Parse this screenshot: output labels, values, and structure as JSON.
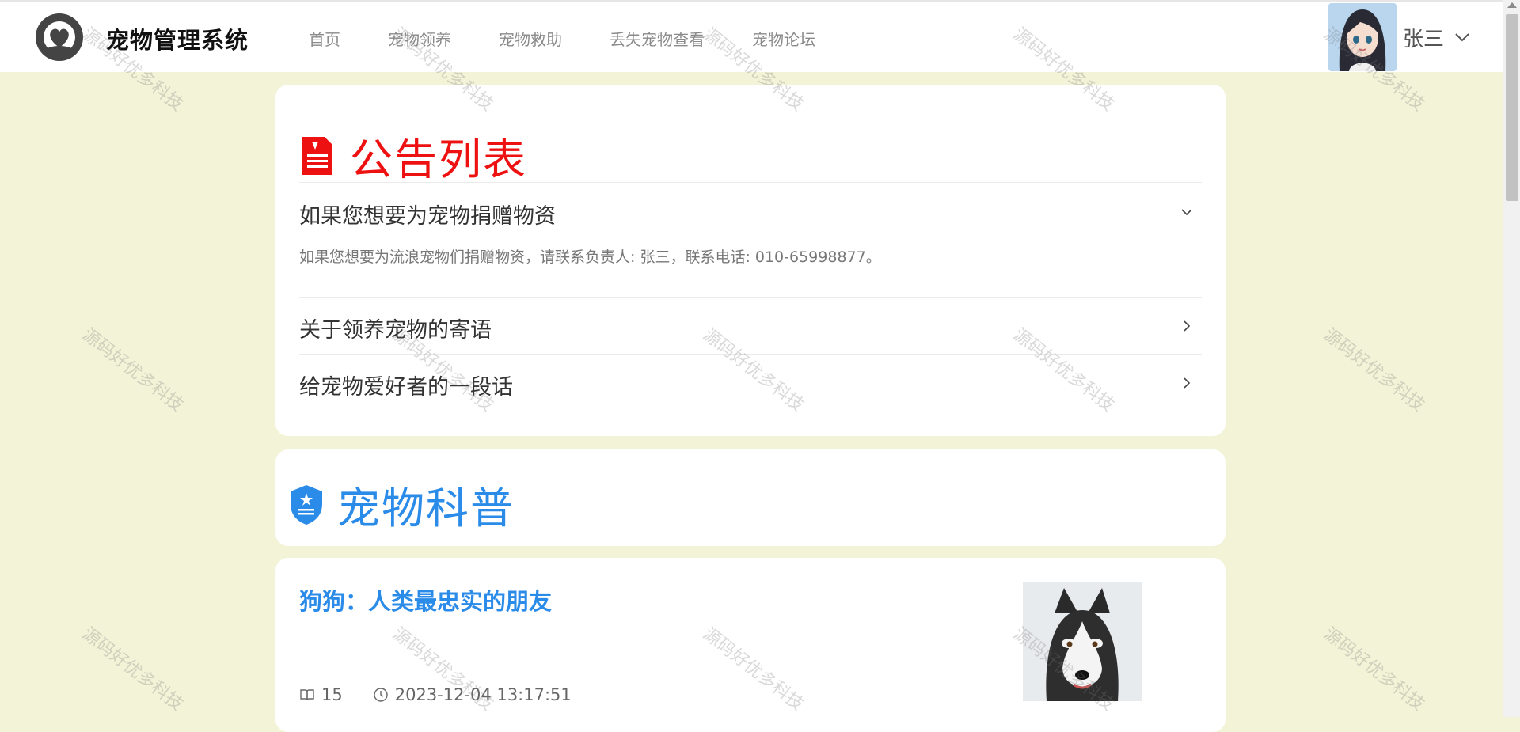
{
  "header": {
    "app_title": "宠物管理系统",
    "nav": [
      "首页",
      "宠物领养",
      "宠物救助",
      "丢失宠物查看",
      "宠物论坛"
    ],
    "username": "张三"
  },
  "notice": {
    "title": "公告列表",
    "items": [
      {
        "title": "如果您想要为宠物捐赠物资",
        "content": "如果您想要为流浪宠物们捐赠物资，请联系负责人: 张三，联系电话: 010-65998877。",
        "expanded": true
      },
      {
        "title": "关于领养宠物的寄语",
        "expanded": false
      },
      {
        "title": "给宠物爱好者的一段话",
        "expanded": false
      }
    ]
  },
  "science": {
    "title": "宠物科普"
  },
  "article": {
    "title": "狗狗：人类最忠实的朋友",
    "views": "15",
    "time": "2023-12-04 13:17:51"
  },
  "watermark": "源码好优多科技",
  "colors": {
    "background": "#f3f3d8",
    "notice_red": "#ee1111",
    "science_blue": "#2a8be8"
  }
}
